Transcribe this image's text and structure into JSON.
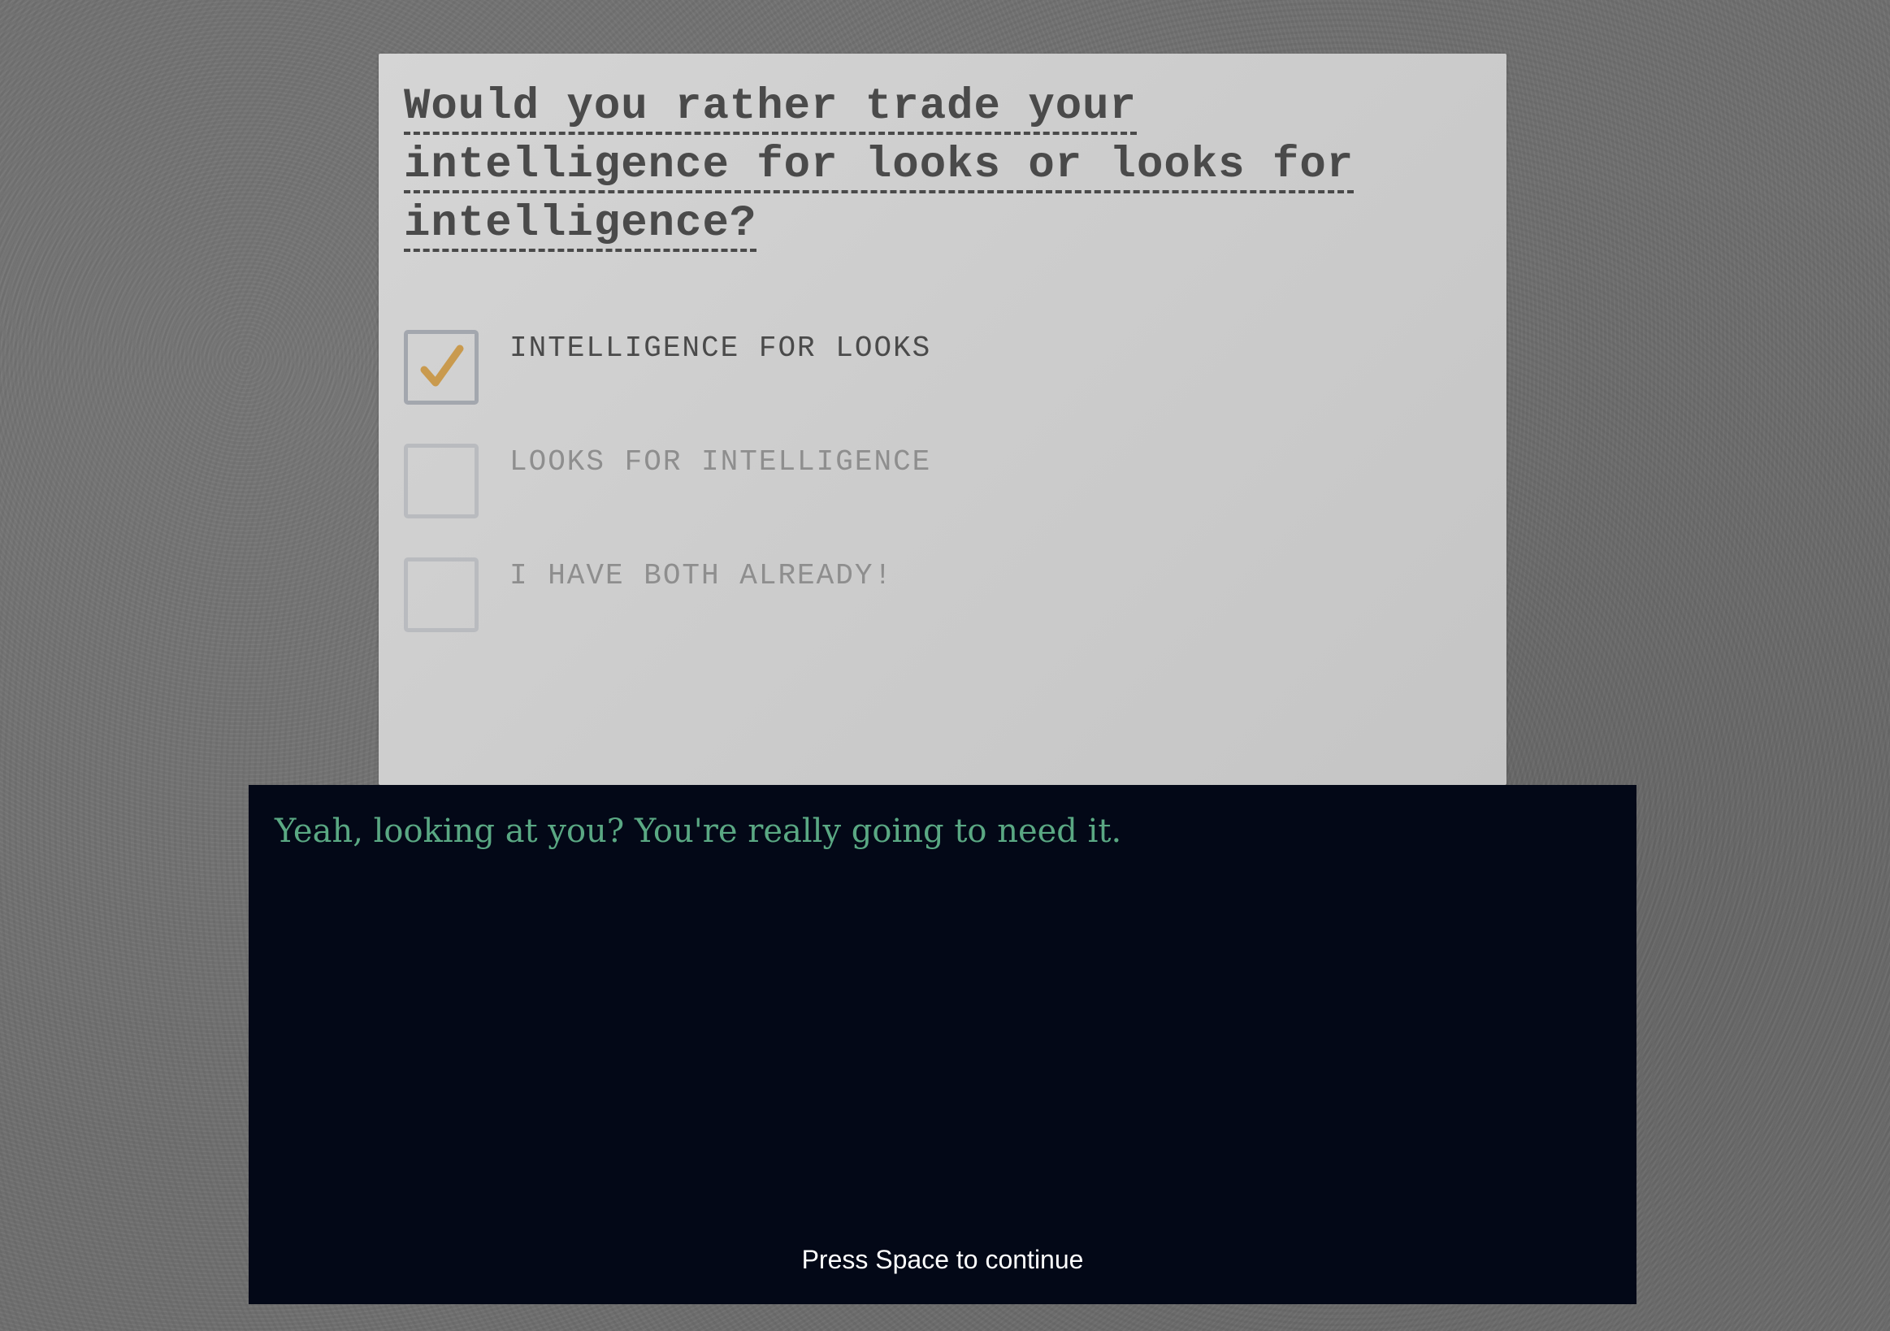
{
  "question": {
    "lines": [
      "Would you rather trade your",
      "intelligence for looks or looks for",
      "intelligence?"
    ]
  },
  "options": [
    {
      "label": "INTELLIGENCE FOR LOOKS",
      "checked": true
    },
    {
      "label": "LOOKS FOR INTELLIGENCE",
      "checked": false
    },
    {
      "label": "I HAVE BOTH ALREADY!",
      "checked": false
    }
  ],
  "dialog": {
    "text": "Yeah, looking at you? You're really going to need it.",
    "prompt": "Press Space to continue"
  },
  "colors": {
    "background": "#6f6f6f",
    "paper": "#cdcdcd",
    "checkmark": "#c99a4e",
    "dialog_bg": "#030817",
    "dialog_text": "#5aa883"
  }
}
